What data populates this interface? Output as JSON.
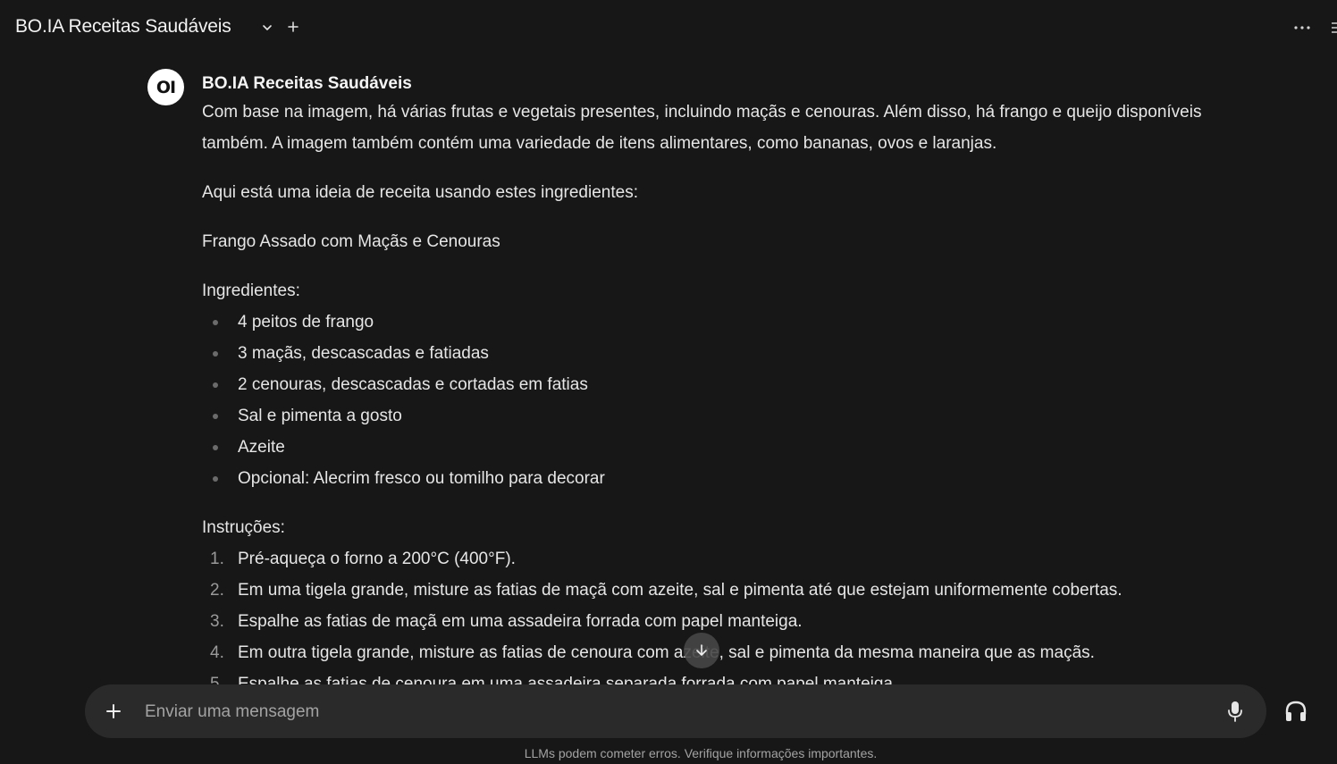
{
  "header": {
    "model_name": "BO.IA Receitas Saudáveis",
    "icons": [
      "chevron-down-icon",
      "plus-icon",
      "more-horizontal-icon"
    ]
  },
  "message": {
    "avatar_text": "OI",
    "sender": "BO.IA Receitas Saudáveis",
    "intro": "Com base na imagem, há várias frutas e vegetais presentes, incluindo maçãs e cenouras. Além disso, há frango e queijo disponíveis também. A imagem também contém uma variedade de itens alimentares, como bananas, ovos e laranjas.",
    "idea": "Aqui está uma ideia de receita usando estes ingredientes:",
    "recipe_title": "Frango Assado com Maçãs e Cenouras",
    "ingredients_label": "Ingredientes:",
    "ingredients": [
      "4 peitos de frango",
      "3 maçãs, descascadas e fatiadas",
      "2 cenouras, descascadas e cortadas em fatias",
      "Sal e pimenta a gosto",
      "Azeite",
      "Opcional: Alecrim fresco ou tomilho para decorar"
    ],
    "instructions_label": "Instruções:",
    "instructions": [
      {
        "num": "1.",
        "text": "Pré-aqueça o forno a 200°C (400°F)."
      },
      {
        "num": "2.",
        "text": "Em uma tigela grande, misture as fatias de maçã com azeite, sal e pimenta até que estejam uniformemente cobertas."
      },
      {
        "num": "3.",
        "text": "Espalhe as fatias de maçã em uma assadeira forrada com papel manteiga."
      },
      {
        "num": "4.",
        "text": "Em outra tigela grande, misture as fatias de cenoura com azeite, sal e pimenta da mesma maneira que as maçãs."
      },
      {
        "num": "5.",
        "text": "Espalhe as fatias de cenoura em uma assadeira separada forrada com papel manteiga."
      }
    ]
  },
  "composer": {
    "placeholder": "Enviar uma mensagem",
    "icons": [
      "plus-icon",
      "microphone-icon",
      "headphones-icon"
    ]
  },
  "footer": {
    "note": "LLMs podem cometer erros. Verifique informações importantes."
  },
  "colors": {
    "background": "#171717",
    "composer": "#2a2a2a",
    "text": "#e6e6e6",
    "muted": "#a3a3a3"
  }
}
